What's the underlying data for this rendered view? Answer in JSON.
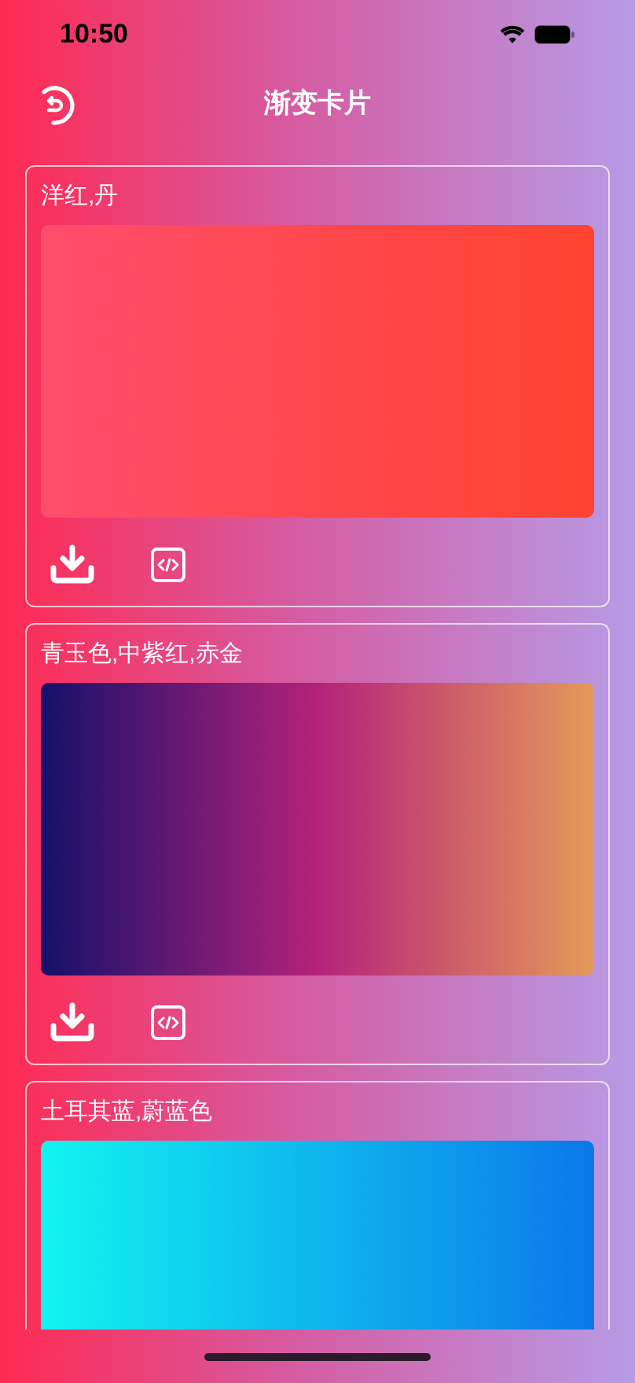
{
  "status_bar": {
    "time": "10:50"
  },
  "header": {
    "title": "渐变卡片"
  },
  "cards": [
    {
      "title": "洋红,丹",
      "stops": [
        {
          "color": "#ff4d6d"
        },
        {
          "color": "#ff4330"
        }
      ],
      "actions": true
    },
    {
      "title": "青玉色,中紫红,赤金",
      "stops": [
        {
          "color": "#15106a"
        },
        {
          "color": "#b5227a"
        },
        {
          "color": "#e49a5a"
        }
      ],
      "actions": true
    },
    {
      "title": "土耳其蓝,蔚蓝色",
      "stops": [
        {
          "color": "#12f4f0"
        },
        {
          "color": "#0b78ea"
        }
      ],
      "actions": false
    }
  ]
}
